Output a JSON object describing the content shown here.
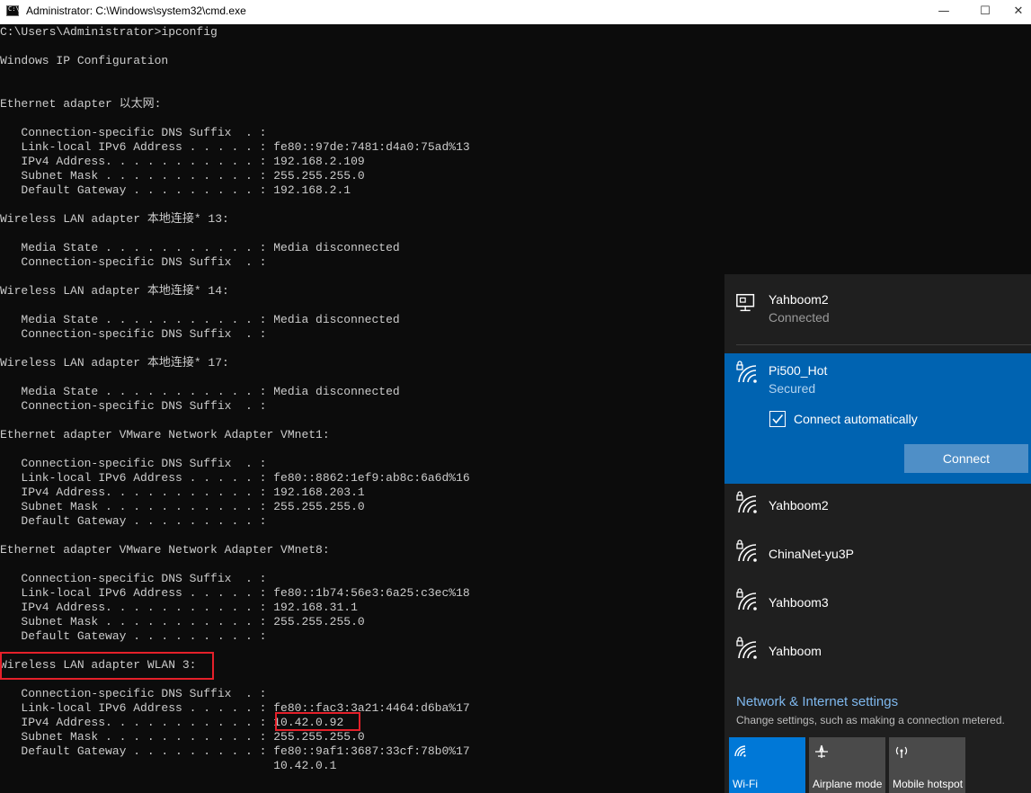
{
  "window": {
    "title": "Administrator: C:\\Windows\\system32\\cmd.exe",
    "min": "—",
    "max": "☐",
    "close": "✕"
  },
  "console": {
    "lines": [
      "C:\\Users\\Administrator>ipconfig",
      "",
      "Windows IP Configuration",
      "",
      "",
      "Ethernet adapter 以太网:",
      "",
      "   Connection-specific DNS Suffix  . :",
      "   Link-local IPv6 Address . . . . . : fe80::97de:7481:d4a0:75ad%13",
      "   IPv4 Address. . . . . . . . . . . : 192.168.2.109",
      "   Subnet Mask . . . . . . . . . . . : 255.255.255.0",
      "   Default Gateway . . . . . . . . . : 192.168.2.1",
      "",
      "Wireless LAN adapter 本地连接* 13:",
      "",
      "   Media State . . . . . . . . . . . : Media disconnected",
      "   Connection-specific DNS Suffix  . :",
      "",
      "Wireless LAN adapter 本地连接* 14:",
      "",
      "   Media State . . . . . . . . . . . : Media disconnected",
      "   Connection-specific DNS Suffix  . :",
      "",
      "Wireless LAN adapter 本地连接* 17:",
      "",
      "   Media State . . . . . . . . . . . : Media disconnected",
      "   Connection-specific DNS Suffix  . :",
      "",
      "Ethernet adapter VMware Network Adapter VMnet1:",
      "",
      "   Connection-specific DNS Suffix  . :",
      "   Link-local IPv6 Address . . . . . : fe80::8862:1ef9:ab8c:6a6d%16",
      "   IPv4 Address. . . . . . . . . . . : 192.168.203.1",
      "   Subnet Mask . . . . . . . . . . . : 255.255.255.0",
      "   Default Gateway . . . . . . . . . :",
      "",
      "Ethernet adapter VMware Network Adapter VMnet8:",
      "",
      "   Connection-specific DNS Suffix  . :",
      "   Link-local IPv6 Address . . . . . : fe80::1b74:56e3:6a25:c3ec%18",
      "   IPv4 Address. . . . . . . . . . . : 192.168.31.1",
      "   Subnet Mask . . . . . . . . . . . : 255.255.255.0",
      "   Default Gateway . . . . . . . . . :",
      "",
      "Wireless LAN adapter WLAN 3:",
      "",
      "   Connection-specific DNS Suffix  . :",
      "   Link-local IPv6 Address . . . . . : fe80::fac3:3a21:4464:d6ba%17",
      "   IPv4 Address. . . . . . . . . . . : 10.42.0.92",
      "   Subnet Mask . . . . . . . . . . . : 255.255.255.0",
      "   Default Gateway . . . . . . . . . : fe80::9af1:3687:33cf:78b0%17",
      "                                       10.42.0.1"
    ]
  },
  "flyout": {
    "connected": {
      "name": "Yahboom2",
      "status": "Connected"
    },
    "selected": {
      "name": "Pi500_Hot",
      "status": "Secured",
      "auto_label": "Connect automatically",
      "auto_checked": true,
      "connect_label": "Connect"
    },
    "networks": [
      "Yahboom2",
      "ChinaNet-yu3P",
      "Yahboom3",
      "Yahboom"
    ],
    "settings_link": "Network & Internet settings",
    "settings_desc": "Change settings, such as making a connection metered.",
    "tiles": [
      {
        "label": "Wi-Fi",
        "icon": "wifi-icon",
        "active": true
      },
      {
        "label": "Airplane mode",
        "icon": "airplane-icon",
        "active": false
      },
      {
        "label": "Mobile hotspot",
        "icon": "hotspot-icon",
        "active": false
      }
    ],
    "accent_color": "#0063b1",
    "highlight_color": "#e5202a"
  }
}
